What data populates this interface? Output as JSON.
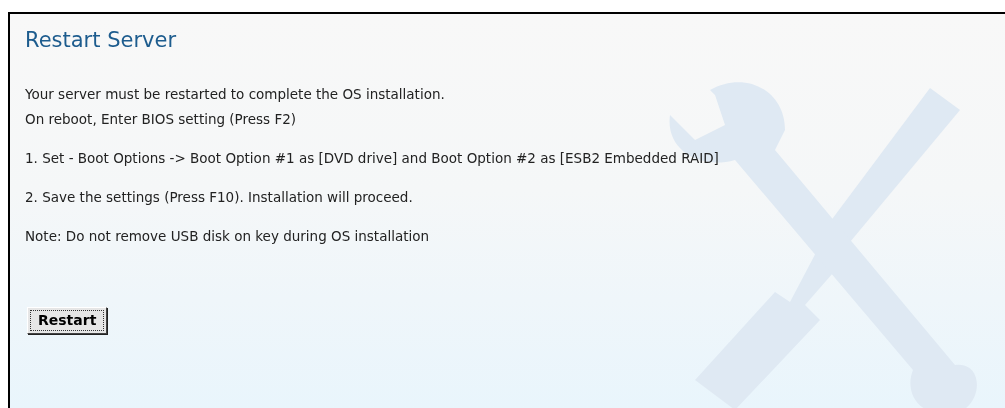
{
  "title": "Restart Server",
  "paragraphs": [
    {
      "lines": [
        "Your server must be restarted to complete the OS installation.",
        "On reboot, Enter BIOS setting (Press F2)"
      ]
    },
    {
      "lines": [
        "1. Set - Boot Options -> Boot Option #1 as [DVD drive] and Boot Option #2 as [ESB2 Embedded RAID]"
      ]
    },
    {
      "lines": [
        "2. Save the settings (Press F10). Installation will proceed."
      ]
    },
    {
      "lines": [
        "Note: Do not remove USB disk on key during OS installation"
      ]
    }
  ],
  "button": {
    "label": "Restart"
  }
}
